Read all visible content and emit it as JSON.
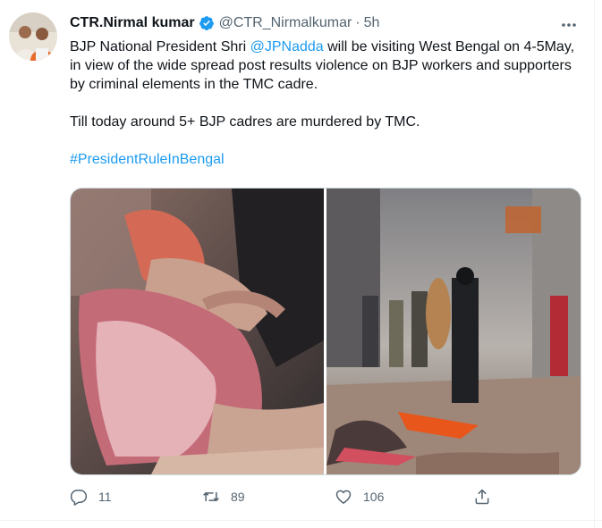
{
  "author": {
    "name": "CTR.Nirmal kumar",
    "handle": "@CTR_Nirmalkumar",
    "separator": "·",
    "time": "5h"
  },
  "tweet": {
    "line1_pre": "BJP National President Shri ",
    "mention": "@JPNadda",
    "line1_post": " will be visiting West Bengal on 4-5May, in view of the wide spread post results violence on BJP workers and supporters by criminal elements in the TMC cadre.",
    "line2": "Till today around 5+ BJP cadres are murdered by TMC.",
    "hashtag": "#PresidentRuleInBengal"
  },
  "actions": {
    "reply_count": "11",
    "retweet_count": "89",
    "like_count": "106"
  },
  "icons": {
    "verified": "verified-badge-icon",
    "more": "more-options-icon",
    "reply": "reply-icon",
    "retweet": "retweet-icon",
    "like": "like-icon",
    "share": "share-icon"
  },
  "colors": {
    "accent": "#1d9bf0",
    "text": "#0f1419",
    "muted": "#536471"
  }
}
